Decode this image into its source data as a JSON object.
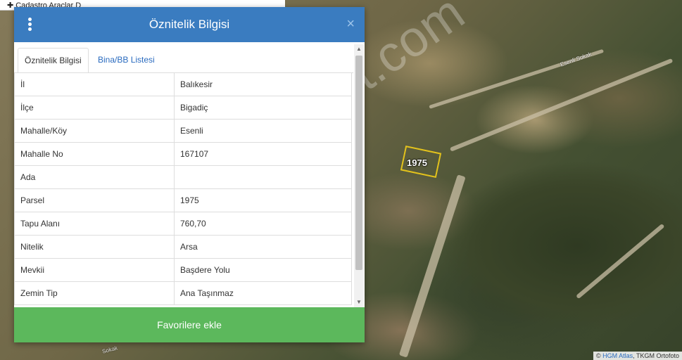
{
  "map": {
    "topbar_text": "✚  Cadastro  Araçlar  D",
    "parcel_label": "1975",
    "street_labels": [
      "Esenli Sokak",
      "Sokak"
    ],
    "watermark": "emlakjet.com",
    "attribution_prefix": "© ",
    "attribution_link": "HGM Atlas",
    "attribution_rest": ", TKGM Ortofoto"
  },
  "dialog": {
    "title": "Öznitelik Bilgisi",
    "close_glyph": "×",
    "tabs": [
      {
        "label": "Öznitelik Bilgisi",
        "active": true
      },
      {
        "label": "Bina/BB Listesi",
        "active": false
      }
    ],
    "rows": [
      {
        "key": "İl",
        "value": "Balıkesir"
      },
      {
        "key": "İlçe",
        "value": "Bigadiç"
      },
      {
        "key": "Mahalle/Köy",
        "value": "Esenli"
      },
      {
        "key": "Mahalle No",
        "value": "167107"
      },
      {
        "key": "Ada",
        "value": ""
      },
      {
        "key": "Parsel",
        "value": "1975"
      },
      {
        "key": "Tapu Alanı",
        "value": "760,70"
      },
      {
        "key": "Nitelik",
        "value": "Arsa"
      },
      {
        "key": "Mevkii",
        "value": "Başdere Yolu"
      },
      {
        "key": "Zemin Tip",
        "value": "Ana Taşınmaz"
      }
    ],
    "favorite_button": "Favorilere ekle"
  },
  "colors": {
    "header": "#3a7cc0",
    "button": "#5cb85c",
    "parcel_outline": "#e3c21c"
  },
  "icons": [
    "menu-dots-icon",
    "close-icon",
    "scroll-up-icon",
    "scroll-down-icon"
  ]
}
